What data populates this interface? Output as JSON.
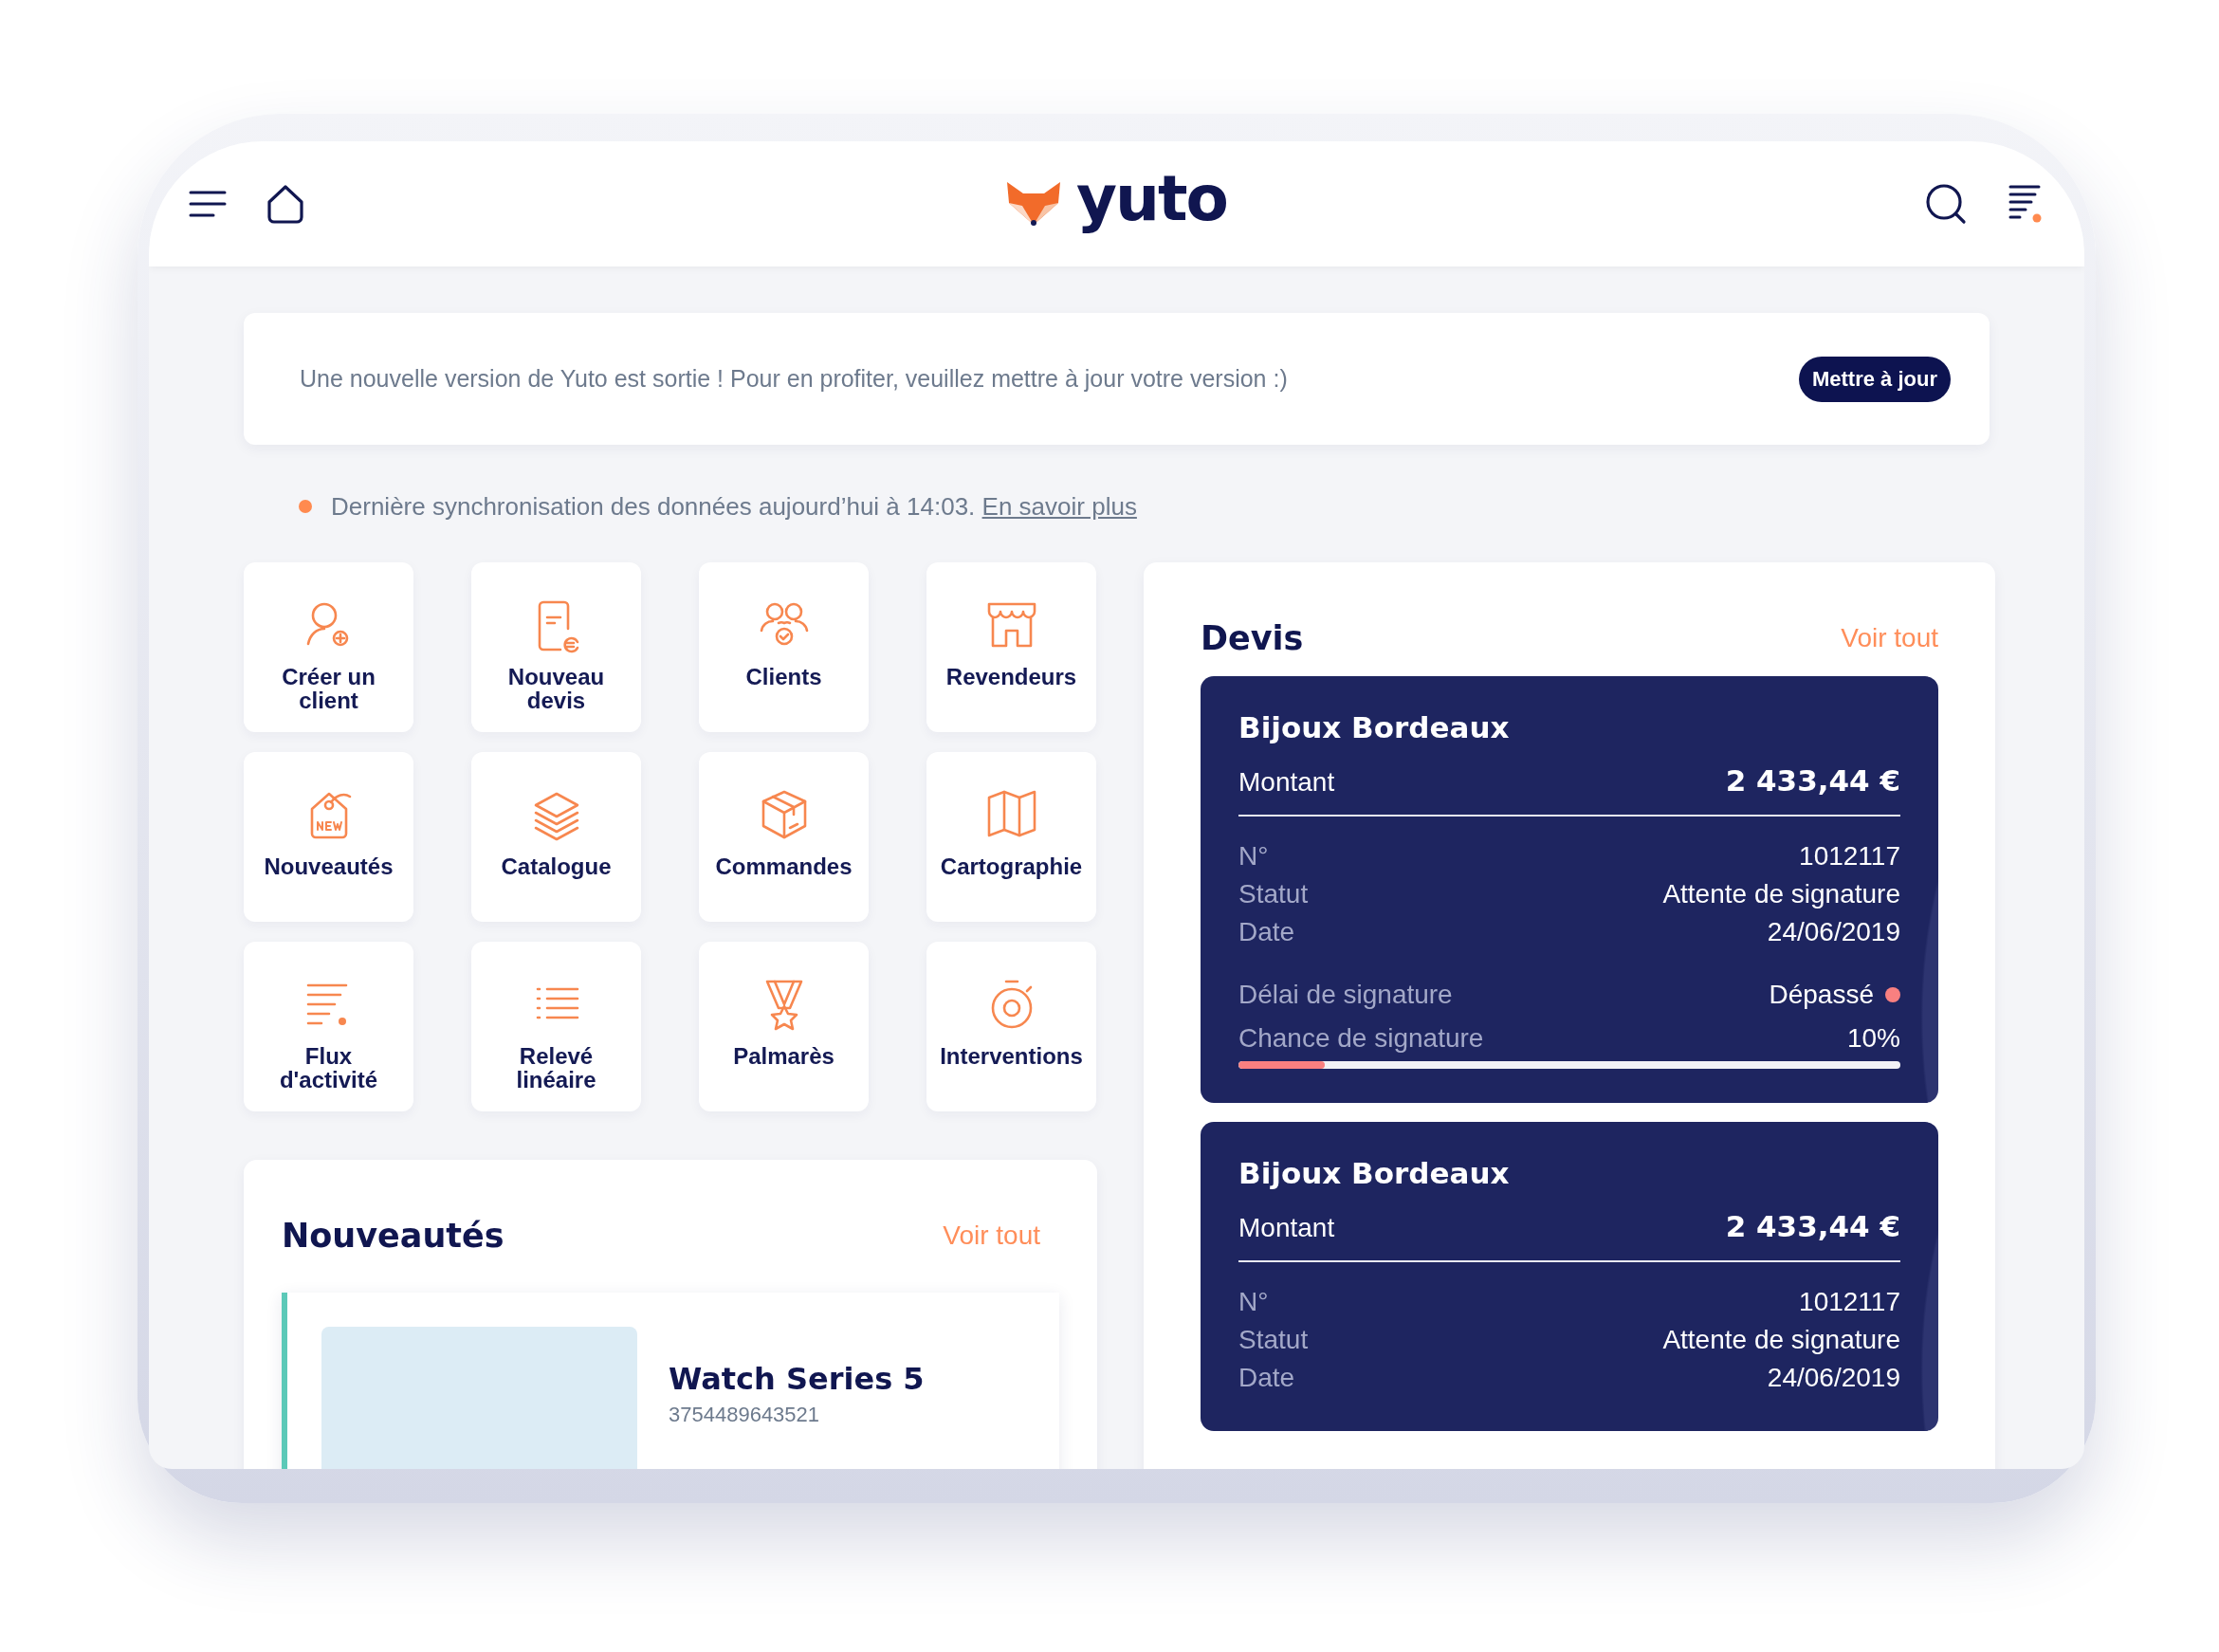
{
  "header": {
    "logo": "yuto"
  },
  "update_banner": {
    "message": "Une nouvelle version de Yuto est sortie ! Pour en profiter, veuillez mettre à jour votre version :)",
    "button": "Mettre à jour"
  },
  "sync": {
    "message": "Dernière synchronisation des données aujourd’hui à 14:03.",
    "link": "En savoir plus"
  },
  "shortcuts": [
    {
      "label": "Créer un\nclient",
      "kind": "user-plus"
    },
    {
      "label": "Nouveau\ndevis",
      "kind": "quote"
    },
    {
      "label": "Clients",
      "kind": "clients"
    },
    {
      "label": "Revendeurs",
      "kind": "store"
    },
    {
      "label": "Nouveautés",
      "kind": "new-tag"
    },
    {
      "label": "Catalogue",
      "kind": "layers"
    },
    {
      "label": "Commandes",
      "kind": "box"
    },
    {
      "label": "Cartographie",
      "kind": "map"
    },
    {
      "label": "Flux\nd'activité",
      "kind": "feed"
    },
    {
      "label": "Relevé\nlinéaire",
      "kind": "list"
    },
    {
      "label": "Palmarès",
      "kind": "medal"
    },
    {
      "label": "Interventions",
      "kind": "stopwatch"
    }
  ],
  "news": {
    "title": "Nouveautés",
    "see_all": "Voir tout",
    "products": [
      {
        "name": "Watch Series 5",
        "code": "3754489643521"
      }
    ]
  },
  "quotes": {
    "title": "Devis",
    "see_all": "Voir tout",
    "items": [
      {
        "client": "Bijoux Bordeaux",
        "amount_label": "Montant",
        "amount": "2 433,44 €",
        "fields": [
          {
            "label": "N°",
            "value": "1012117"
          },
          {
            "label": "Statut",
            "value": "Attente de signature"
          },
          {
            "label": "Date",
            "value": "24/06/2019"
          }
        ],
        "deadline": {
          "label": "Délai de signature",
          "value": "Dépassé"
        },
        "chance": {
          "label": "Chance de signature",
          "value": "10%",
          "level": 0.13
        }
      },
      {
        "client": "Bijoux Bordeaux",
        "amount_label": "Montant",
        "amount": "2 433,44 €",
        "fields": [
          {
            "label": "N°",
            "value": "1012117"
          },
          {
            "label": "Statut",
            "value": "Attente de signature"
          },
          {
            "label": "Date",
            "value": "24/06/2019"
          }
        ]
      }
    ]
  }
}
